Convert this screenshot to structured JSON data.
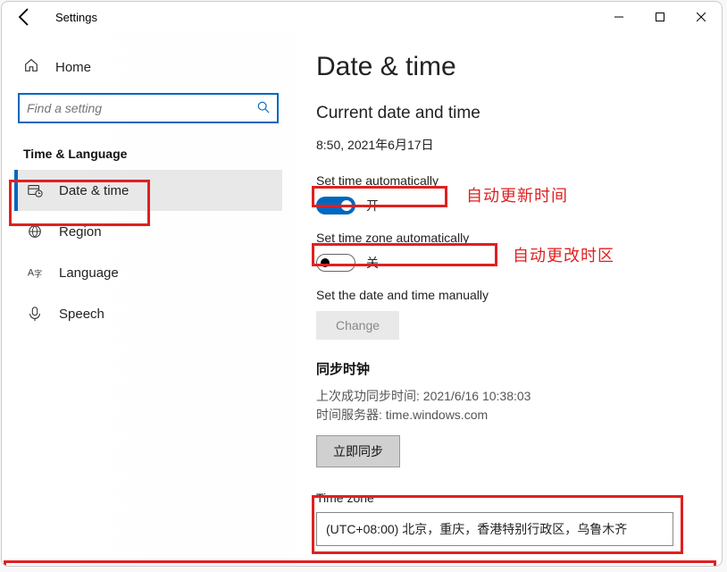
{
  "titlebar": {
    "title": "Settings"
  },
  "sidebar": {
    "home": "Home",
    "search_placeholder": "Find a setting",
    "section": "Time & Language",
    "items": [
      {
        "label": "Date & time"
      },
      {
        "label": "Region"
      },
      {
        "label": "Language"
      },
      {
        "label": "Speech"
      }
    ]
  },
  "main": {
    "heading": "Date & time",
    "subheading": "Current date and time",
    "datetime": "8:50, 2021年6月17日",
    "auto_time_label": "Set time automatically",
    "auto_time_state": "开",
    "auto_tz_label": "Set time zone automatically",
    "auto_tz_state": "关",
    "manual_label": "Set the date and time manually",
    "change_btn": "Change",
    "sync_heading": "同步时钟",
    "sync_last": "上次成功同步时间: 2021/6/16 10:38:03",
    "sync_server": "时间服务器: time.windows.com",
    "sync_now_btn": "立即同步",
    "tz_label": "Time zone",
    "tz_value": "(UTC+08:00) 北京，重庆，香港特别行政区，乌鲁木齐"
  },
  "annotations": {
    "auto_time": "自动更新时间",
    "auto_tz": "自动更改时区"
  }
}
